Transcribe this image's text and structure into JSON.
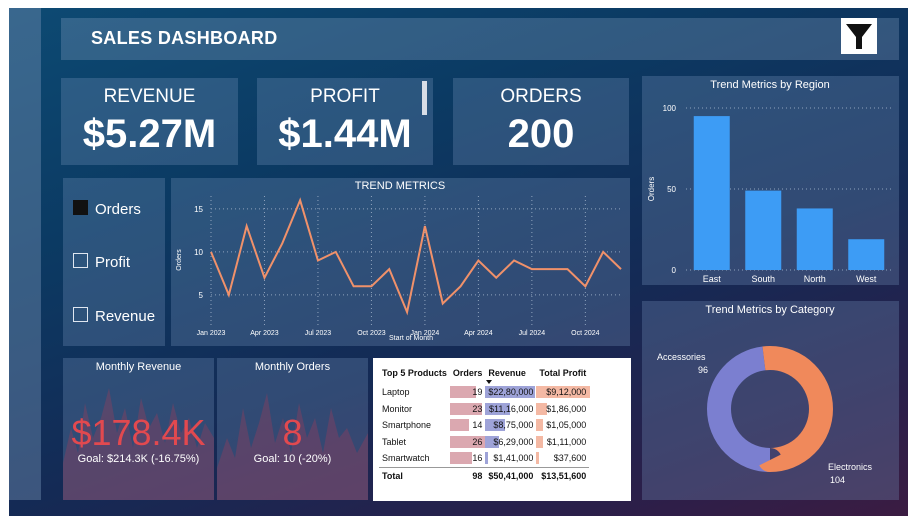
{
  "header": {
    "title": "SALES DASHBOARD",
    "filter_icon": "funnel-icon"
  },
  "kpis": [
    {
      "label": "REVENUE",
      "value": "$5.27M"
    },
    {
      "label": "PROFIT",
      "value": "$1.44M"
    },
    {
      "label": "ORDERS",
      "value": "200"
    }
  ],
  "metric_selector": [
    {
      "label": "Orders",
      "checked": true
    },
    {
      "label": "Profit",
      "checked": false
    },
    {
      "label": "Revenue",
      "checked": false
    }
  ],
  "monthly_revenue": {
    "title": "Monthly Revenue",
    "value": "$178.4K",
    "goal": "Goal: $214.3K (-16.75%)",
    "value_color": "#e2494f"
  },
  "monthly_orders": {
    "title": "Monthly Orders",
    "value": "8",
    "goal": "Goal: 10 (-20%)",
    "value_color": "#e2494f"
  },
  "top5": {
    "headers": [
      "Top 5 Products",
      "Orders",
      "Revenue",
      "Total Profit"
    ],
    "rows": [
      {
        "product": "Laptop",
        "orders": "19",
        "revenue": "$22,80,000",
        "profit": "$9,12,000",
        "o": 19,
        "r": 2280000,
        "p": 912000
      },
      {
        "product": "Monitor",
        "orders": "23",
        "revenue": "$11,16,000",
        "profit": "$1,86,000",
        "o": 23,
        "r": 1116000,
        "p": 186000
      },
      {
        "product": "Smartphone",
        "orders": "14",
        "revenue": "$8,75,000",
        "profit": "$1,05,000",
        "o": 14,
        "r": 875000,
        "p": 105000
      },
      {
        "product": "Tablet",
        "orders": "26",
        "revenue": "$6,29,000",
        "profit": "$1,11,000",
        "o": 26,
        "r": 629000,
        "p": 111000
      },
      {
        "product": "Smartwatch",
        "orders": "16",
        "revenue": "$1,41,000",
        "profit": "$37,600",
        "o": 16,
        "r": 141000,
        "p": 37600
      }
    ],
    "total": {
      "product": "Total",
      "orders": "98",
      "revenue": "$50,41,000",
      "profit": "$13,51,600"
    },
    "colors": {
      "orders": "#dba8b0",
      "revenue": "#9ea3d8",
      "profit": "#f4b9a4"
    }
  },
  "chart_data": [
    {
      "type": "line",
      "title": "TREND METRICS",
      "xlabel": "Start of Month",
      "ylabel": "Orders",
      "x_ticks": [
        "Jan 2023",
        "Apr 2023",
        "Jul 2023",
        "Oct 2023",
        "Jan 2024",
        "Apr 2024",
        "Jul 2024",
        "Oct 2024"
      ],
      "y_ticks": [
        5,
        10,
        15
      ],
      "ylim": [
        1.5,
        16.5
      ],
      "x": [
        "2023-01",
        "2023-02",
        "2023-03",
        "2023-04",
        "2023-05",
        "2023-06",
        "2023-07",
        "2023-08",
        "2023-09",
        "2023-10",
        "2023-11",
        "2023-12",
        "2024-01",
        "2024-02",
        "2024-03",
        "2024-04",
        "2024-05",
        "2024-06",
        "2024-07",
        "2024-08",
        "2024-09",
        "2024-10",
        "2024-11",
        "2024-12"
      ],
      "values": [
        10,
        5,
        13,
        7,
        11,
        16,
        9,
        10,
        6,
        6,
        8,
        3,
        13,
        4,
        6,
        9,
        7,
        9,
        8,
        8,
        8,
        6,
        10,
        8
      ],
      "color": "#f0916a",
      "grid": true
    },
    {
      "type": "bar",
      "title": "Trend Metrics by Region",
      "ylabel": "Orders",
      "categories": [
        "East",
        "South",
        "North",
        "West"
      ],
      "values": [
        95,
        49,
        38,
        19
      ],
      "y_ticks": [
        0,
        50,
        100
      ],
      "ylim": [
        0,
        100
      ],
      "color": "#3d9cf5",
      "grid": true
    },
    {
      "type": "pie",
      "title": "Trend Metrics by Category",
      "categories": [
        "Accessories",
        "Electronics"
      ],
      "values": [
        96,
        104
      ],
      "colors": [
        "#7b7fd0",
        "#f0895b"
      ],
      "donut": true
    }
  ]
}
